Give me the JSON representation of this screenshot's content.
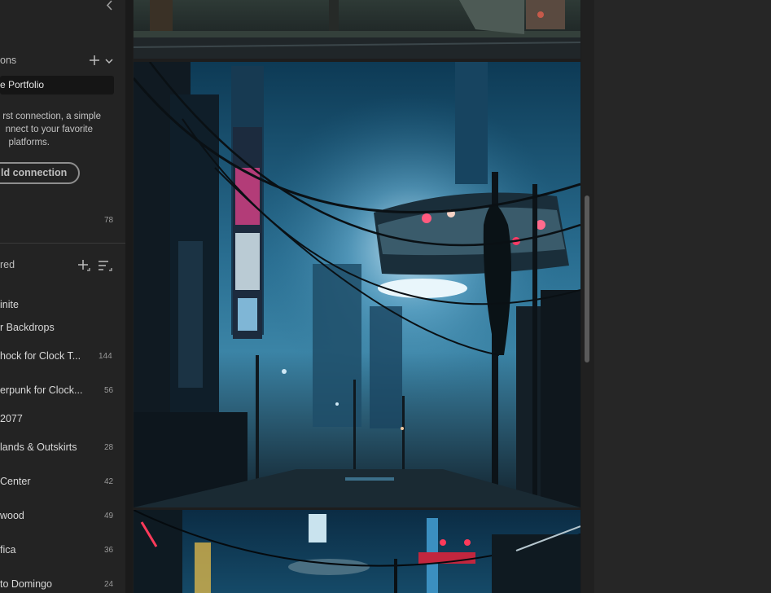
{
  "sidebar": {
    "connections": {
      "title": "ons",
      "active_item": "e Portfolio",
      "help_lines": [
        "rst connection, a simple",
        "nnect to your favorite",
        "platforms."
      ],
      "add_button_label": "ld connection",
      "count": "78"
    },
    "shared": {
      "title": "red",
      "albums": [
        {
          "label": "inite",
          "count": ""
        },
        {
          "label": "r Backdrops",
          "count": ""
        },
        {
          "label": "hock for Clock T...",
          "count": "144"
        },
        {
          "label": "erpunk for Clock...",
          "count": "56"
        },
        {
          "label": "2077",
          "count": ""
        },
        {
          "label": "lands & Outskirts",
          "count": "28"
        },
        {
          "label": "Center",
          "count": "42"
        },
        {
          "label": "wood",
          "count": "49"
        },
        {
          "label": "fica",
          "count": "36"
        },
        {
          "label": "to Domingo",
          "count": "24"
        }
      ]
    }
  },
  "icons": {
    "collapse": "chevron-left-icon",
    "add": "plus-icon",
    "expand": "chevron-down-icon",
    "add_album": "plus-icon",
    "sort": "sort-lines-icon"
  },
  "colors": {
    "sidebar_bg": "#232323",
    "panel_bg": "#1d1d1d",
    "active_item_bg": "#151515",
    "accent_neon_pink": "#ff2e5a",
    "city_teal": "#2b7fa8"
  }
}
